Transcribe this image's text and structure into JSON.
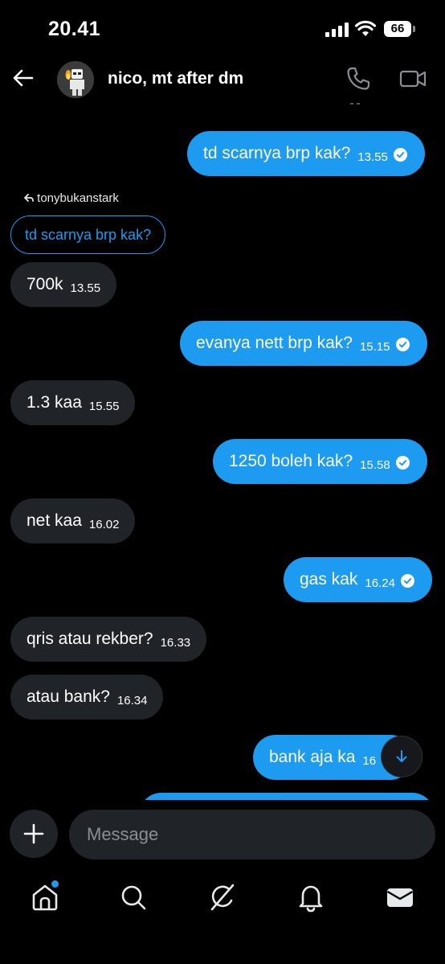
{
  "status_bar": {
    "time": "20.41",
    "battery": "66"
  },
  "header": {
    "title": "nico, mt after dm"
  },
  "reply": {
    "author": "tonybukanstark",
    "quoted_text": "td scarnya brp kak?"
  },
  "messages": [
    {
      "direction": "out",
      "text": "td scarnya brp kak?",
      "time": "13.55",
      "read": true
    },
    {
      "direction": "in",
      "text": "700k",
      "time": "13.55"
    },
    {
      "direction": "out",
      "text": "evanya nett brp kak?",
      "time": "15.15",
      "read": true
    },
    {
      "direction": "in",
      "text": "1.3 kaa",
      "time": "15.55"
    },
    {
      "direction": "out",
      "text": "1250 boleh kak?",
      "time": "15.58",
      "read": true
    },
    {
      "direction": "in",
      "text": "net kaa",
      "time": "16.02"
    },
    {
      "direction": "out",
      "text": "gas kak",
      "time": "16.24",
      "read": true
    },
    {
      "direction": "in",
      "text": "qris atau rekber?",
      "time": "16.33"
    },
    {
      "direction": "in",
      "text": "atau bank?",
      "time": "16.34"
    },
    {
      "direction": "out",
      "text": "bank aja ka",
      "time": "16",
      "read": true
    }
  ],
  "composer": {
    "placeholder": "Message"
  },
  "icons": {
    "back": "arrow-left-icon",
    "call": "phone-icon",
    "video": "video-camera-icon",
    "add": "plus-icon",
    "scroll": "arrow-down-icon",
    "tabs": [
      "home-icon",
      "search-icon",
      "grok-icon",
      "bell-icon",
      "mail-icon"
    ]
  },
  "colors": {
    "accent": "#1d9bf0",
    "incoming_bubble": "#202327",
    "background": "#000000"
  }
}
